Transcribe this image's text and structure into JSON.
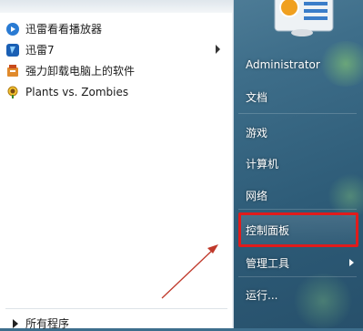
{
  "programs": [
    {
      "label": "迅雷看看播放器",
      "icon": "xunlei-kankan-icon",
      "has_submenu": false
    },
    {
      "label": "迅雷7",
      "icon": "xunlei7-icon",
      "has_submenu": true
    },
    {
      "label": "强力卸载电脑上的软件",
      "icon": "uninstall-icon",
      "has_submenu": false
    },
    {
      "label": "Plants vs. Zombies",
      "icon": "plants-vs-zombies-icon",
      "has_submenu": false
    }
  ],
  "all_programs_label": "所有程序",
  "right_items": [
    {
      "label": "Administrator",
      "has_submenu": false
    },
    {
      "label": "文档",
      "has_submenu": false
    },
    {
      "label": "游戏",
      "has_submenu": false
    },
    {
      "label": "计算机",
      "has_submenu": false
    },
    {
      "label": "网络",
      "has_submenu": false
    },
    {
      "label": "控制面板",
      "has_submenu": false,
      "highlighted": true
    },
    {
      "label": "管理工具",
      "has_submenu": true
    },
    {
      "label": "运行...",
      "has_submenu": false
    }
  ],
  "colors": {
    "highlight_box": "#e01b1b",
    "annotation_arrow": "#c0392b"
  }
}
